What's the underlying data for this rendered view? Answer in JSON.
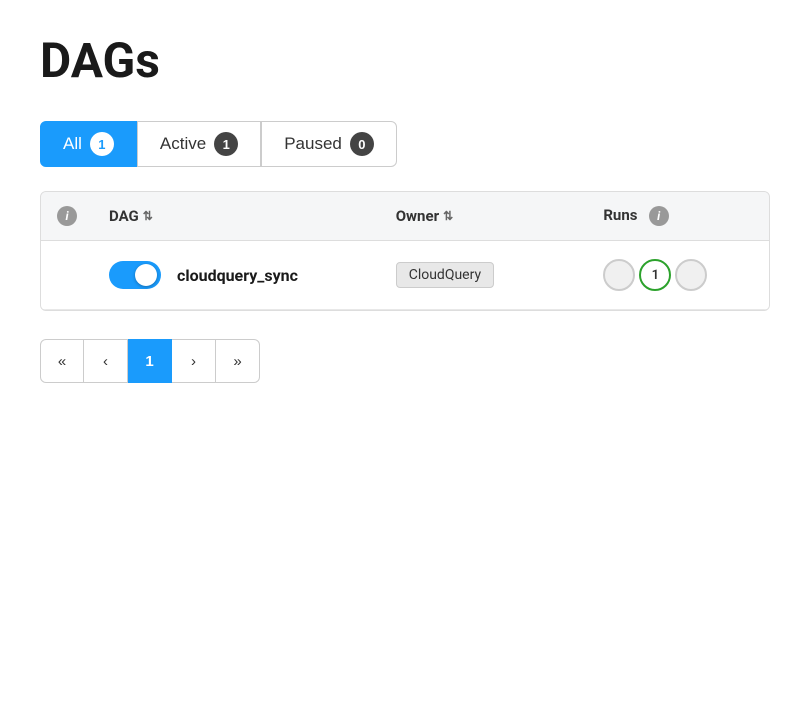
{
  "page": {
    "title": "DAGs"
  },
  "filters": {
    "tabs": [
      {
        "id": "all",
        "label": "All",
        "count": 1,
        "active": true
      },
      {
        "id": "active",
        "label": "Active",
        "count": 1,
        "active": false
      },
      {
        "id": "paused",
        "label": "Paused",
        "count": 0,
        "active": false
      }
    ]
  },
  "table": {
    "columns": {
      "info": "",
      "dag": "DAG",
      "owner": "Owner",
      "runs": "Runs"
    },
    "rows": [
      {
        "dag_name": "cloudquery_sync",
        "owner": "CloudQuery",
        "toggle_on": true,
        "runs": [
          {
            "value": "",
            "type": "empty"
          },
          {
            "value": "1",
            "type": "success"
          },
          {
            "value": "",
            "type": "empty"
          }
        ]
      }
    ]
  },
  "pagination": {
    "buttons": [
      {
        "label": "«",
        "type": "first"
      },
      {
        "label": "‹",
        "type": "prev"
      },
      {
        "label": "1",
        "type": "page",
        "current": true
      },
      {
        "label": "›",
        "type": "next"
      },
      {
        "label": "»",
        "type": "last"
      }
    ]
  }
}
